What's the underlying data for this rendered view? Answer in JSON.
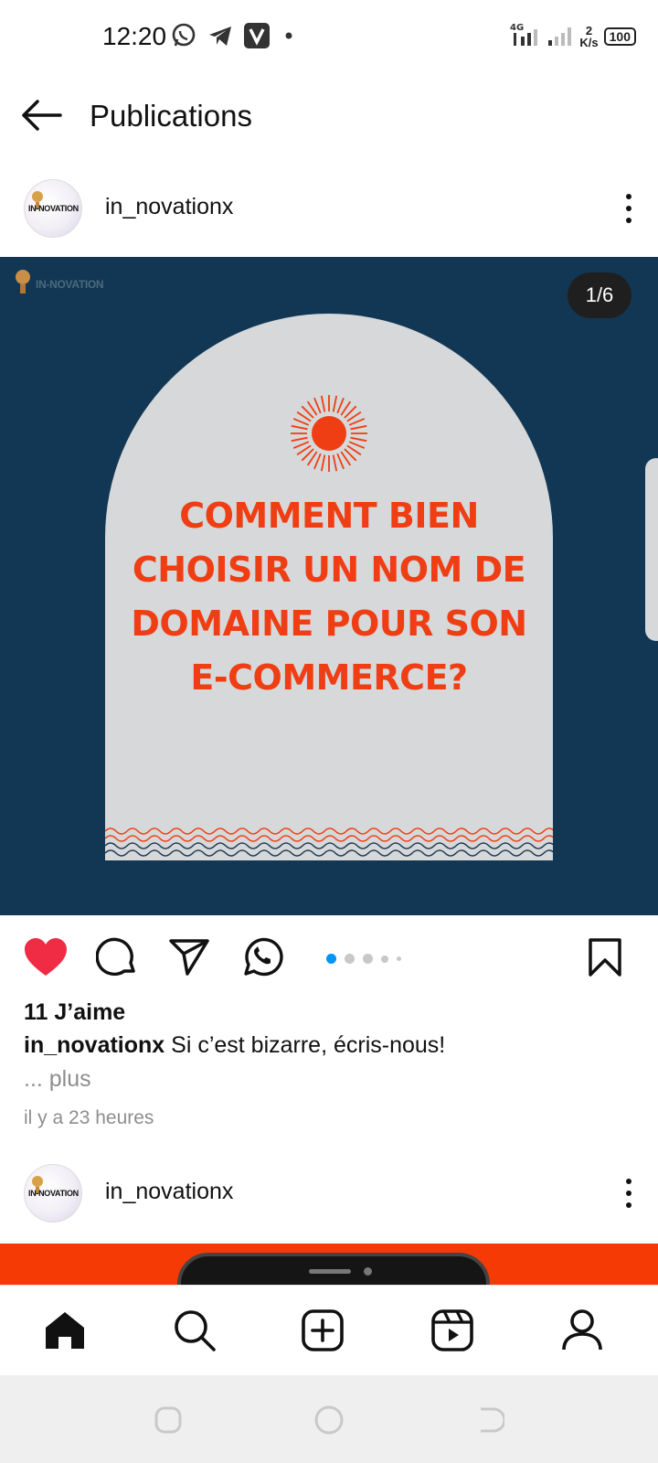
{
  "status_bar": {
    "time": "12:20",
    "app_icons": [
      "whatsapp-icon",
      "telegram-icon",
      "v-app-icon",
      "dot"
    ],
    "network_type": "4G",
    "net_speed_value": "2",
    "net_speed_unit": "K/s",
    "battery": "100"
  },
  "header": {
    "title": "Publications"
  },
  "post": {
    "username": "in_novationx",
    "avatar_text": "IN-NOVATION",
    "image": {
      "brand_mark": "IN-NOVATION",
      "counter": "1/6",
      "headline_lines": [
        "COMMENT BIEN",
        "CHOISIR UN NOM DE",
        "DOMAINE POUR SON",
        "E-COMMERCE?"
      ],
      "colors": {
        "background": "#123754",
        "arch": "#d6d8da",
        "accent": "#ef3e13"
      }
    },
    "carousel": {
      "total": 6,
      "current": 1
    },
    "likes": "11 J’aime",
    "caption_user": "in_novationx",
    "caption_text": "Si c’est bizarre, écris-nous!",
    "more_label": "... plus",
    "timestamp": "il y a 23 heures"
  },
  "next_post": {
    "username": "in_novationx",
    "avatar_text": "IN-NOVATION"
  },
  "bottom_nav": {
    "items": [
      "home-icon",
      "search-icon",
      "create-icon",
      "reels-icon",
      "profile-icon"
    ],
    "active": "home-icon"
  },
  "system_nav": [
    "recent-apps-icon",
    "home-circle-icon",
    "back-icon"
  ]
}
